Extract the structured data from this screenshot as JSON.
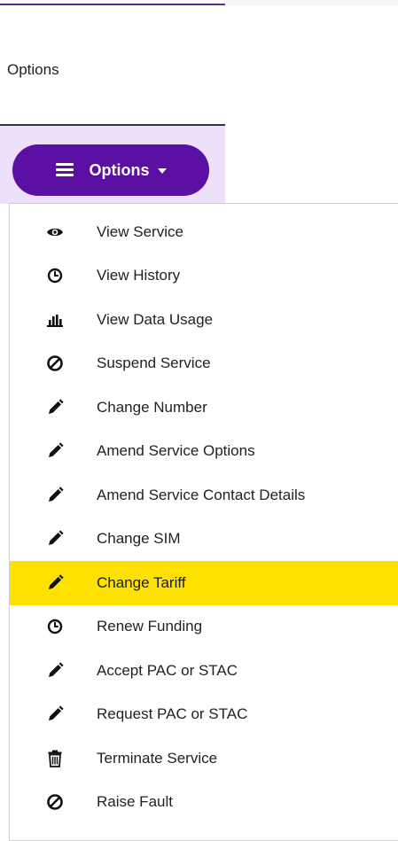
{
  "header": {
    "title": "Options"
  },
  "options_button": {
    "label": "Options"
  },
  "menu": {
    "items": [
      {
        "label": "View Service",
        "icon": "eye-icon"
      },
      {
        "label": "View History",
        "icon": "clock-icon"
      },
      {
        "label": "View Data Usage",
        "icon": "bar-chart-icon"
      },
      {
        "label": "Suspend Service",
        "icon": "ban-icon"
      },
      {
        "label": "Change Number",
        "icon": "pencil-icon"
      },
      {
        "label": "Amend Service Options",
        "icon": "pencil-icon"
      },
      {
        "label": "Amend Service Contact Details",
        "icon": "pencil-icon"
      },
      {
        "label": "Change SIM",
        "icon": "pencil-icon"
      },
      {
        "label": "Change Tariff",
        "icon": "pencil-icon",
        "highlighted": true
      },
      {
        "label": "Renew Funding",
        "icon": "clock-icon"
      },
      {
        "label": "Accept PAC or STAC",
        "icon": "pencil-icon"
      },
      {
        "label": "Request PAC or STAC",
        "icon": "pencil-icon"
      },
      {
        "label": "Terminate Service",
        "icon": "trash-icon"
      },
      {
        "label": "Raise Fault",
        "icon": "ban-icon"
      }
    ]
  },
  "colors": {
    "accent": "#5b0fa3",
    "button_band": "#ede0fb",
    "highlight": "#ffe100"
  }
}
